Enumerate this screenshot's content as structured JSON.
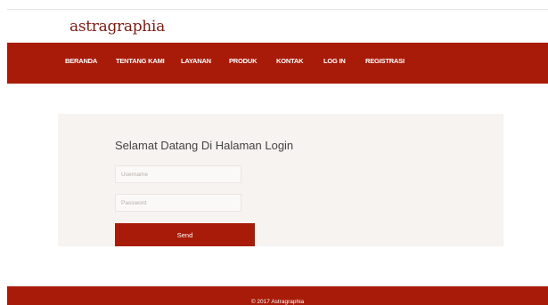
{
  "brand": {
    "name": "astragraphia"
  },
  "nav": {
    "items": [
      {
        "label": "BERANDA"
      },
      {
        "label": "TENTANG KAMI"
      },
      {
        "label": "LAYANAN"
      },
      {
        "label": "PRODUK"
      },
      {
        "label": "KONTAK"
      },
      {
        "label": "LOG IN"
      },
      {
        "label": "REGISTRASI"
      }
    ]
  },
  "login": {
    "title": "Selamat Datang Di Halaman Login",
    "username": {
      "placeholder": "Username",
      "value": ""
    },
    "password": {
      "placeholder": "Password",
      "value": ""
    },
    "send_label": "Send"
  },
  "footer": {
    "text": "© 2017 Astragraphia"
  },
  "colors": {
    "accent": "#a81b09",
    "brand_text": "#7b1d12",
    "panel_bg": "#f6f3f1"
  }
}
